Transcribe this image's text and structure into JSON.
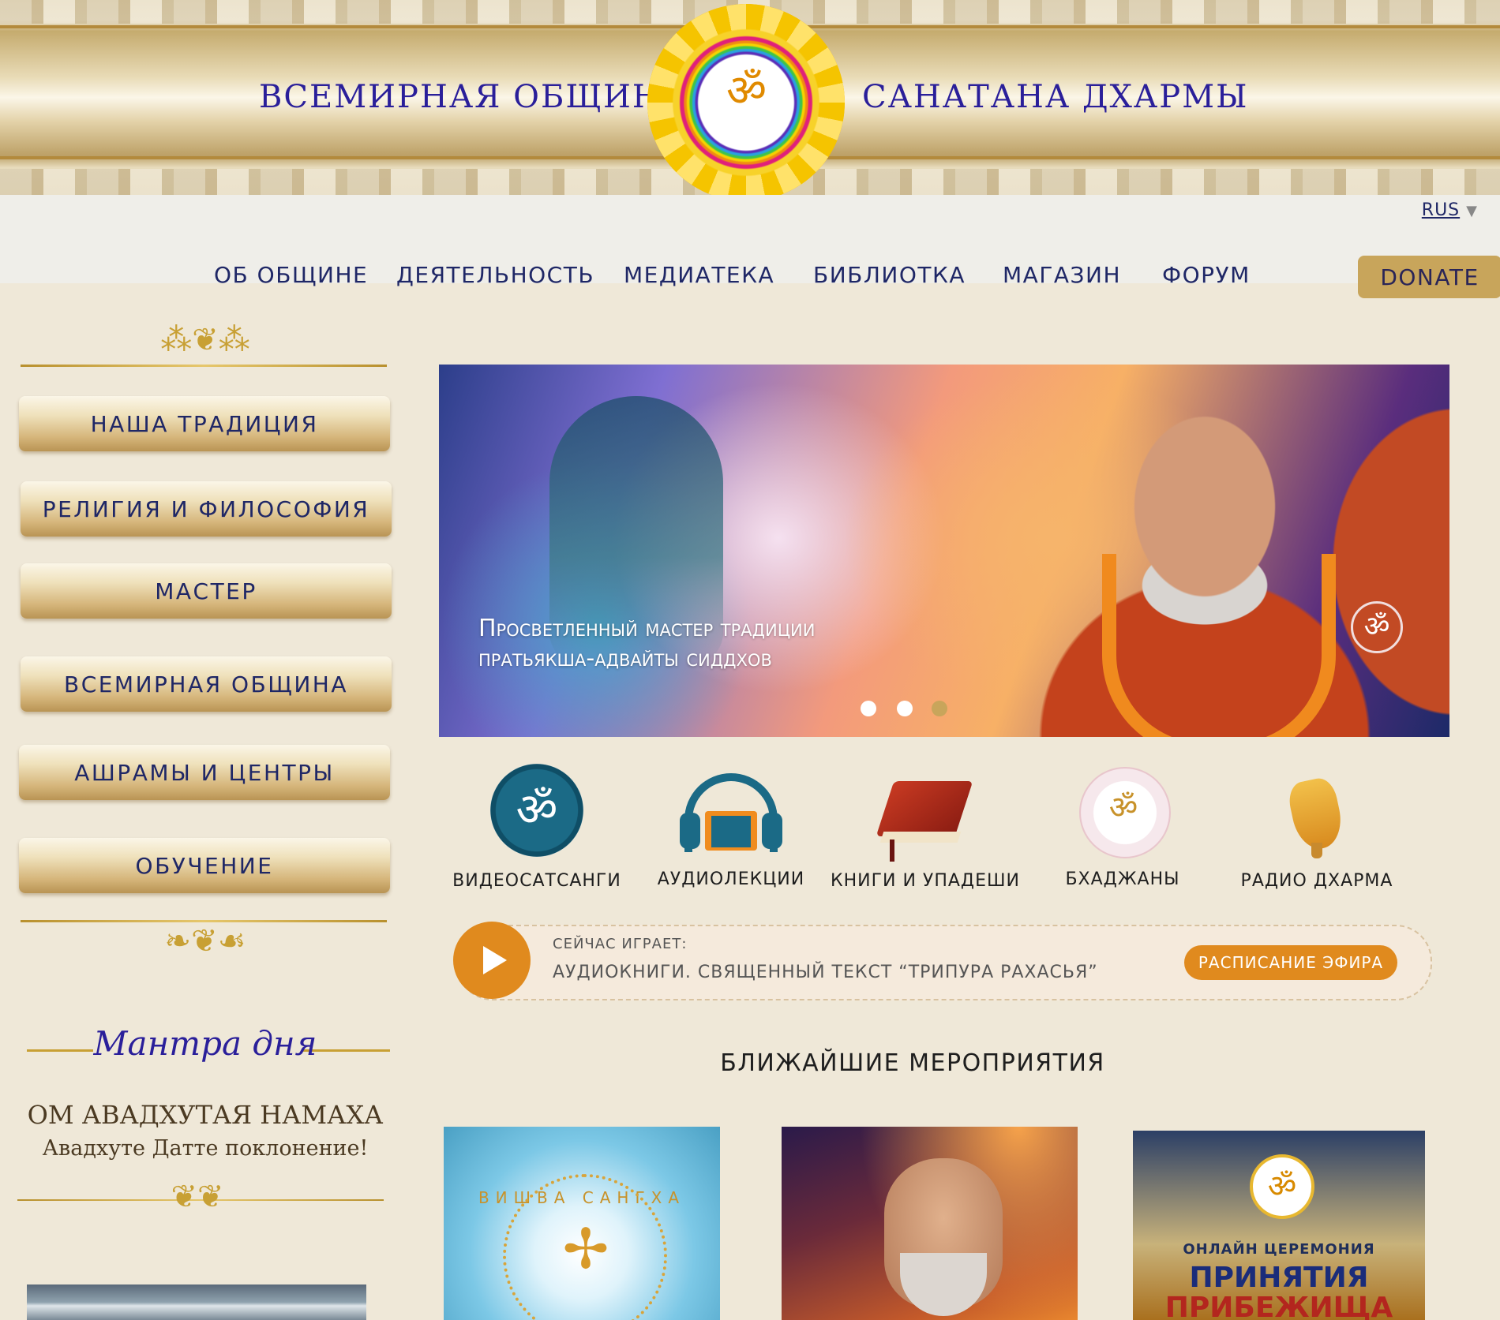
{
  "header": {
    "title_left": "ВСЕМИРНАЯ ОБЩИНА",
    "title_right": "САНАТАНА ДХАРМЫ",
    "logo_symbol": "ॐ"
  },
  "language": {
    "current": "RUS",
    "caret": "▼"
  },
  "nav": {
    "items": [
      {
        "label": "ОБ ОБЩИНЕ"
      },
      {
        "label": "ДЕЯТЕЛЬНОСТЬ"
      },
      {
        "label": "МЕДИАТЕКА"
      },
      {
        "label": "БИБЛИОТКА"
      },
      {
        "label": "МАГАЗИН"
      },
      {
        "label": "ФОРУМ"
      }
    ],
    "donate_label": "DONATE"
  },
  "sidebar": {
    "buttons": [
      {
        "label": "НАША ТРАДИЦИЯ"
      },
      {
        "label": "РЕЛИГИЯ И ФИЛОСОФИЯ"
      },
      {
        "label": "МАСТЕР"
      },
      {
        "label": "ВСЕМИРНАЯ ОБЩИНА"
      },
      {
        "label": "АШРАМЫ И ЦЕНТРЫ"
      },
      {
        "label": "ОБУЧЕНИЕ"
      }
    ],
    "mantra": {
      "heading": "Мантра дня",
      "text": "ОМ АВАДХУТАЯ НАМАХА",
      "translation": "Авадхуте Датте поклонение!"
    }
  },
  "slider": {
    "caption_line1": "Просветленный мастер традиции",
    "caption_line2": "пратьякша-адвайты сиддхов",
    "om_badge": "ॐ",
    "active_slide": 1,
    "slide_count": 3
  },
  "categories": [
    {
      "label": "ВИДЕОСАТСАНГИ",
      "icon": "om-video-icon",
      "glyph": "ॐ"
    },
    {
      "label": "АУДИОЛЕКЦИИ",
      "icon": "headphones-book-icon"
    },
    {
      "label": "КНИГИ И УПАДЕШИ",
      "icon": "book-icon"
    },
    {
      "label": "БХАДЖАНЫ",
      "icon": "bhajan-seal-icon",
      "glyph": "ॐ"
    },
    {
      "label": "РАДИО ДХАРМА",
      "icon": "conch-shell-icon"
    }
  ],
  "player": {
    "now_playing_label": "СЕЙЧАС ИГРАЕТ:",
    "track": "АУДИОКНИГИ. СВЯЩЕННЫЙ ТЕКСТ “ТРИПУРА РАХАСЬЯ”",
    "schedule_label": "РАСПИСАНИЕ ЭФИРА"
  },
  "events": {
    "title": "БЛИЖАЙШИЕ МЕРОПРИЯТИЯ",
    "cards": [
      {
        "arc_text": "ВИШВА САНГХА"
      },
      {},
      {
        "logo": "ॐ",
        "line1": "ОНЛАЙН ЦЕРЕМОНИЯ",
        "line2": "ПРИНЯТИЯ",
        "line3": "ПРИБЕЖИЩА"
      }
    ]
  },
  "colors": {
    "page_bg": "#efe8d8",
    "nav_text": "#1f2766",
    "title_purple": "#2a1f9a",
    "gold": "#c8a55b",
    "accent_orange": "#e08a1e"
  }
}
